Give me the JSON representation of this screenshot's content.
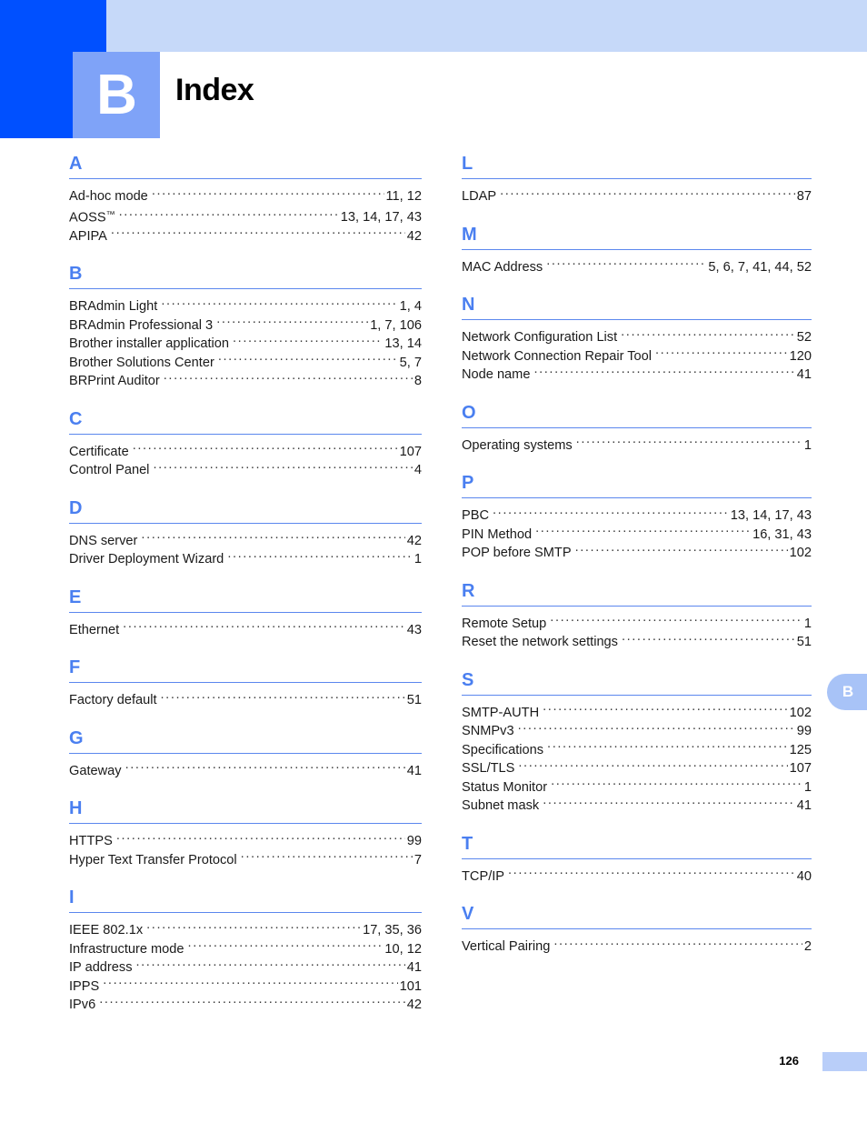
{
  "header": {
    "chapter_letter": "B",
    "title": "Index"
  },
  "thumb_tab": {
    "letter": "B"
  },
  "footer": {
    "page_number": "126"
  },
  "colors": {
    "dark_blue": "#0050ff",
    "light_blue_banner": "#c6d9f9",
    "chapter_box": "#7fa3f8",
    "section_letter": "#4a7ff0",
    "rule": "#5b87ee",
    "thumb_tab": "#a8c3f7",
    "footer_bar": "#b9cef9"
  },
  "columns": [
    {
      "name": "left",
      "groups": [
        {
          "letter": "A",
          "entries": [
            {
              "term": "Ad-hoc mode",
              "pages": "11, 12"
            },
            {
              "term": "AOSS",
              "trademark": true,
              "pages": "13, 14, 17, 43"
            },
            {
              "term": "APIPA",
              "pages": "42"
            }
          ]
        },
        {
          "letter": "B",
          "entries": [
            {
              "term": "BRAdmin Light",
              "pages": "1, 4"
            },
            {
              "term": "BRAdmin Professional 3",
              "pages": "1, 7, 106"
            },
            {
              "term": "Brother installer application",
              "pages": "13, 14"
            },
            {
              "term": "Brother Solutions Center",
              "pages": "5, 7"
            },
            {
              "term": "BRPrint Auditor",
              "pages": "8"
            }
          ]
        },
        {
          "letter": "C",
          "entries": [
            {
              "term": "Certificate",
              "pages": "107"
            },
            {
              "term": "Control Panel",
              "pages": "4"
            }
          ]
        },
        {
          "letter": "D",
          "entries": [
            {
              "term": "DNS server",
              "pages": "42"
            },
            {
              "term": "Driver Deployment Wizard",
              "pages": "1"
            }
          ]
        },
        {
          "letter": "E",
          "entries": [
            {
              "term": "Ethernet",
              "pages": "43"
            }
          ]
        },
        {
          "letter": "F",
          "entries": [
            {
              "term": "Factory default",
              "pages": "51"
            }
          ]
        },
        {
          "letter": "G",
          "entries": [
            {
              "term": "Gateway",
              "pages": "41"
            }
          ]
        },
        {
          "letter": "H",
          "entries": [
            {
              "term": "HTTPS",
              "pages": "99"
            },
            {
              "term": "Hyper Text Transfer Protocol",
              "pages": "7"
            }
          ]
        },
        {
          "letter": "I",
          "entries": [
            {
              "term": "IEEE 802.1x",
              "pages": "17, 35, 36"
            },
            {
              "term": "Infrastructure mode",
              "pages": "10, 12"
            },
            {
              "term": "IP address",
              "pages": "41"
            },
            {
              "term": "IPPS",
              "pages": "101"
            },
            {
              "term": "IPv6",
              "pages": "42"
            }
          ]
        }
      ]
    },
    {
      "name": "right",
      "groups": [
        {
          "letter": "L",
          "entries": [
            {
              "term": "LDAP",
              "pages": "87"
            }
          ]
        },
        {
          "letter": "M",
          "entries": [
            {
              "term": "MAC Address",
              "pages": "5, 6, 7, 41, 44, 52"
            }
          ]
        },
        {
          "letter": "N",
          "entries": [
            {
              "term": "Network Configuration List",
              "pages": "52"
            },
            {
              "term": "Network Connection Repair Tool",
              "pages": "120"
            },
            {
              "term": "Node name",
              "pages": "41"
            }
          ]
        },
        {
          "letter": "O",
          "entries": [
            {
              "term": "Operating systems",
              "pages": "1"
            }
          ]
        },
        {
          "letter": "P",
          "entries": [
            {
              "term": "PBC",
              "pages": "13, 14, 17, 43"
            },
            {
              "term": "PIN Method",
              "pages": "16, 31, 43"
            },
            {
              "term": "POP before SMTP",
              "pages": "102"
            }
          ]
        },
        {
          "letter": "R",
          "entries": [
            {
              "term": "Remote Setup",
              "pages": "1"
            },
            {
              "term": "Reset the network settings",
              "pages": "51"
            }
          ]
        },
        {
          "letter": "S",
          "entries": [
            {
              "term": "SMTP-AUTH",
              "pages": "102"
            },
            {
              "term": "SNMPv3",
              "pages": "99"
            },
            {
              "term": "Specifications",
              "pages": "125"
            },
            {
              "term": "SSL/TLS",
              "pages": "107"
            },
            {
              "term": "Status Monitor",
              "pages": "1"
            },
            {
              "term": "Subnet mask",
              "pages": "41"
            }
          ]
        },
        {
          "letter": "T",
          "entries": [
            {
              "term": "TCP/IP",
              "pages": "40"
            }
          ]
        },
        {
          "letter": "V",
          "entries": [
            {
              "term": "Vertical Pairing",
              "pages": "2"
            }
          ]
        }
      ]
    }
  ]
}
